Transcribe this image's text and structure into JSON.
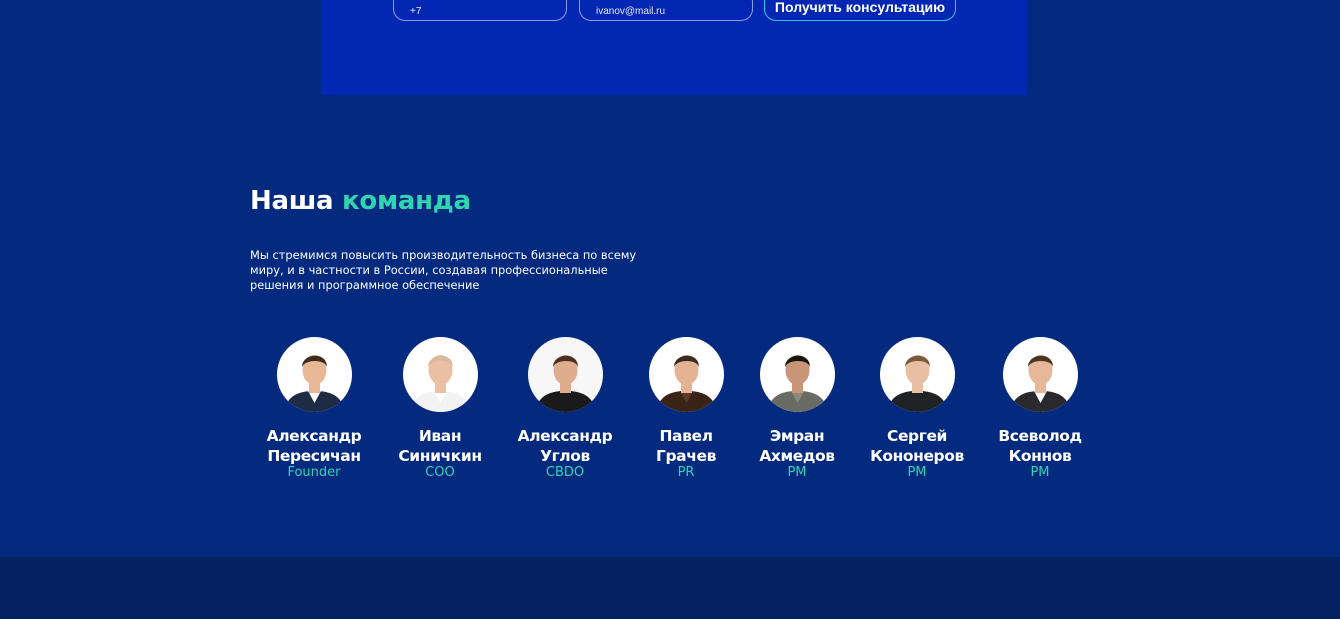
{
  "form": {
    "phone_placeholder": "+7",
    "email_placeholder": "ivanov@mail.ru",
    "submit_label": "Получить консультацию"
  },
  "team": {
    "title_main": "Наша",
    "title_accent": "команда",
    "description": "Мы стремимся повысить производительность бизнеса по всему миру, и в частности в России, создавая профессиональные решения и программное обеспечение",
    "members": [
      {
        "first": "Александр",
        "last": "Пересичан",
        "role": "Founder",
        "suit": "#1f2a44",
        "shirt": "#ffffff",
        "hair": "#3b2a1e",
        "skin": "#e8b796",
        "bg": "#ffffff"
      },
      {
        "first": "Иван",
        "last": "Синичкин",
        "role": "COO",
        "suit": "#f3f3f3",
        "shirt": "#ffffff",
        "hair": "#d9b9a0",
        "skin": "#e9c0a4",
        "bg": "#ffffff"
      },
      {
        "first": "Александр",
        "last": "Углов",
        "role": "CBDO",
        "suit": "#1a1a1a",
        "shirt": "#1a1a1a",
        "hair": "#4a3020",
        "skin": "#e0ac8e",
        "bg": "#f7f7f7"
      },
      {
        "first": "Павел",
        "last": "Грачев",
        "role": "PR",
        "suit": "#3a2418",
        "shirt": "#5a3a28",
        "hair": "#3a2a20",
        "skin": "#e4b394",
        "bg": "#ffffff"
      },
      {
        "first": "Эмран",
        "last": "Ахмедов",
        "role": "PM",
        "suit": "#6b6b66",
        "shirt": "#8a8a80",
        "hair": "#1a1411",
        "skin": "#c99578",
        "bg": "#ffffff"
      },
      {
        "first": "Сергей",
        "last": "Кононеров",
        "role": "PM",
        "suit": "#202326",
        "shirt": "#202326",
        "hair": "#7a5a3e",
        "skin": "#e8bfa2",
        "bg": "#ffffff"
      },
      {
        "first": "Всеволод",
        "last": "Коннов",
        "role": "PM",
        "suit": "#2a2a2e",
        "shirt": "#ffffff",
        "hair": "#4a3424",
        "skin": "#e7b79a",
        "bg": "#ffffff"
      }
    ]
  }
}
